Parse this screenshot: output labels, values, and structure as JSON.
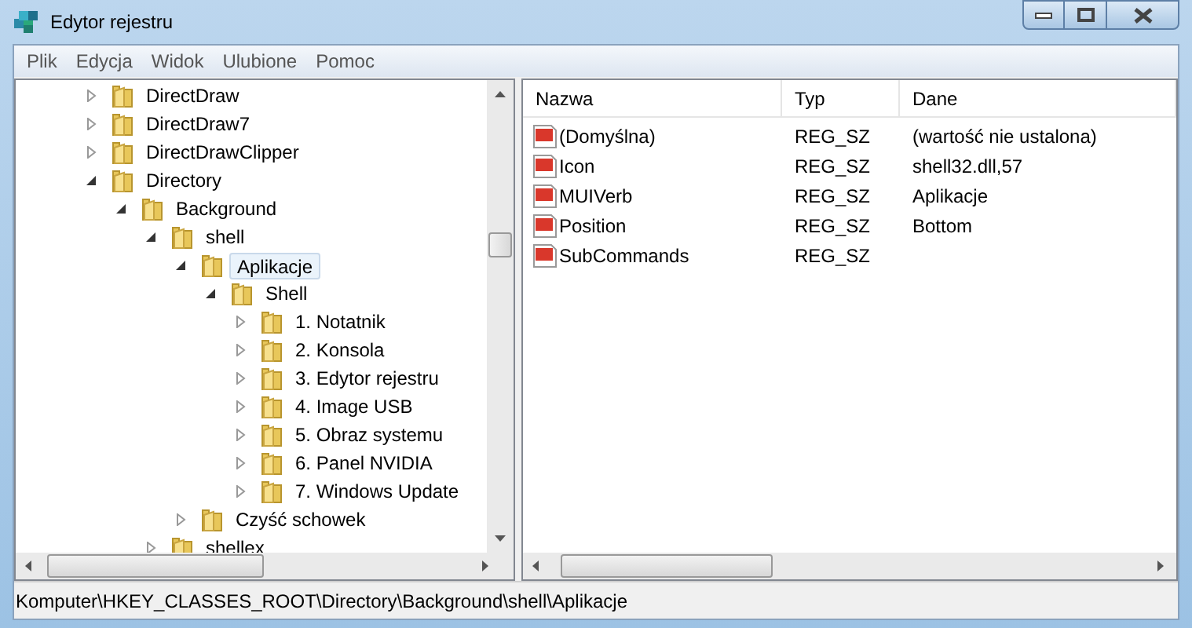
{
  "window": {
    "title": "Edytor rejestru"
  },
  "menu": [
    "Plik",
    "Edycja",
    "Widok",
    "Ulubione",
    "Pomoc"
  ],
  "tree": [
    {
      "label": "DirectDraw",
      "expanded": false,
      "selected": false
    },
    {
      "label": "DirectDraw7",
      "expanded": false,
      "selected": false
    },
    {
      "label": "DirectDrawClipper",
      "expanded": false,
      "selected": false
    },
    {
      "label": "Directory",
      "expanded": true,
      "selected": false,
      "children": [
        {
          "label": "Background",
          "expanded": true,
          "selected": false,
          "children": [
            {
              "label": "shell",
              "expanded": true,
              "selected": false,
              "children": [
                {
                  "label": "Aplikacje",
                  "expanded": true,
                  "selected": true,
                  "children": [
                    {
                      "label": "Shell",
                      "expanded": true,
                      "selected": false,
                      "children": [
                        {
                          "label": "1. Notatnik",
                          "expanded": false,
                          "selected": false
                        },
                        {
                          "label": "2. Konsola",
                          "expanded": false,
                          "selected": false
                        },
                        {
                          "label": "3. Edytor rejestru",
                          "expanded": false,
                          "selected": false
                        },
                        {
                          "label": "4. Image USB",
                          "expanded": false,
                          "selected": false
                        },
                        {
                          "label": "5. Obraz systemu",
                          "expanded": false,
                          "selected": false
                        },
                        {
                          "label": "6. Panel NVIDIA",
                          "expanded": false,
                          "selected": false
                        },
                        {
                          "label": "7. Windows Update",
                          "expanded": false,
                          "selected": false
                        }
                      ]
                    }
                  ]
                },
                {
                  "label": "Czyść schowek",
                  "expanded": false,
                  "selected": false
                }
              ]
            },
            {
              "label": "shellex",
              "expanded": false,
              "selected": false
            }
          ]
        }
      ]
    }
  ],
  "values": {
    "columns": [
      "Nazwa",
      "Typ",
      "Dane"
    ],
    "rows": [
      {
        "name": "(Domyślna)",
        "type": "REG_SZ",
        "data": "(wartość nie ustalona)"
      },
      {
        "name": "Icon",
        "type": "REG_SZ",
        "data": "shell32.dll,57"
      },
      {
        "name": "MUIVerb",
        "type": "REG_SZ",
        "data": "Aplikacje"
      },
      {
        "name": "Position",
        "type": "REG_SZ",
        "data": "Bottom"
      },
      {
        "name": "SubCommands",
        "type": "REG_SZ"
      }
    ]
  },
  "status_bar": "Komputer\\HKEY_CLASSES_ROOT\\Directory\\Background\\shell\\Aplikacje"
}
